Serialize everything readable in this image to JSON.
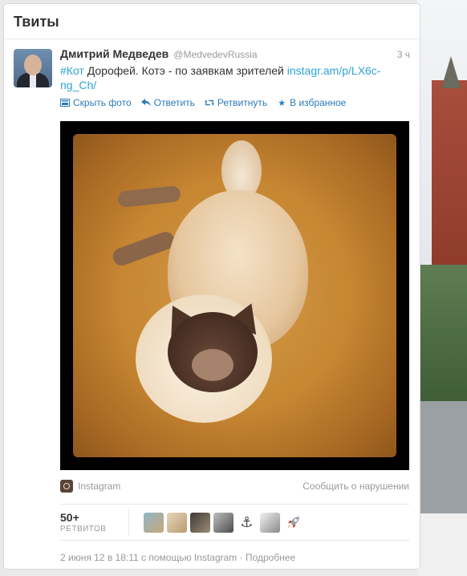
{
  "panel": {
    "title": "Твиты"
  },
  "tweet": {
    "fullname": "Дмитрий Медведев",
    "username": "@MedvedevRussia",
    "time": "3 ч",
    "hashtag": "#Кот",
    "text": " Дорофей. Котэ - по заявкам зрителей ",
    "link": "instagr.am/p/LX6c-ng_Ch/"
  },
  "actions": [
    {
      "label": "Скрыть фото",
      "icon": "photo-icon"
    },
    {
      "label": "Ответить",
      "icon": "reply-icon"
    },
    {
      "label": "Ретвитнуть",
      "icon": "retweet-icon"
    },
    {
      "label": "В избранное",
      "icon": "star-icon"
    }
  ],
  "media": {
    "source_label": "Instagram",
    "report_label": "Сообщить о нарушении"
  },
  "stats": {
    "retweet_count": "50+",
    "retweet_label": "РЕТВИТОВ"
  },
  "footer": {
    "text": "2 июня 12 в 18:11 с помощью Instagram · Подробнее"
  },
  "colors": {
    "link": "#2fa3d6",
    "action": "#2b7bb9",
    "muted": "#999999"
  }
}
